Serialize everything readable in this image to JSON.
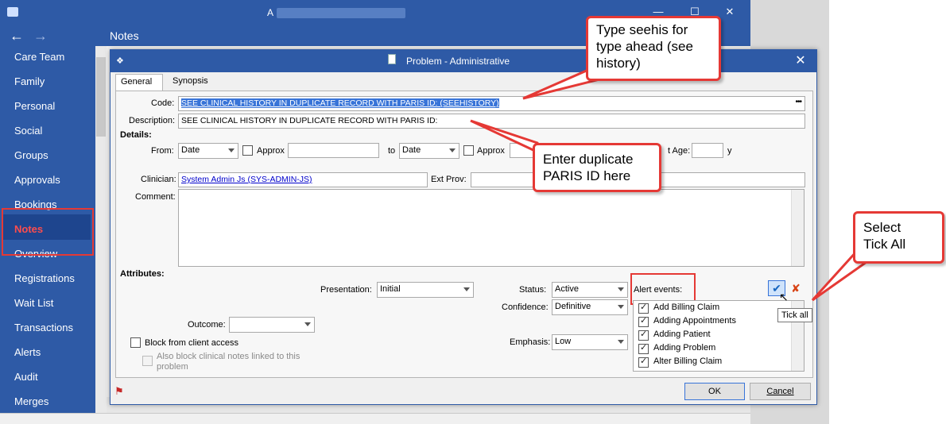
{
  "app": {
    "title": "A",
    "nav_title": "Notes",
    "back_icon": "arrow-left-icon",
    "forward_icon": "arrow-right-icon",
    "controls": [
      "minimize-icon",
      "maximize-icon",
      "close-icon"
    ]
  },
  "sidebar": {
    "items": [
      {
        "label": "Care Team"
      },
      {
        "label": "Family"
      },
      {
        "label": "Personal"
      },
      {
        "label": "Social"
      },
      {
        "label": "Groups"
      },
      {
        "label": "Approvals"
      },
      {
        "label": "Bookings"
      },
      {
        "label": "Notes"
      },
      {
        "label": "Overview"
      },
      {
        "label": "Registrations"
      },
      {
        "label": "Wait List"
      },
      {
        "label": "Transactions"
      },
      {
        "label": "Alerts"
      },
      {
        "label": "Audit"
      },
      {
        "label": "Merges"
      }
    ],
    "selected": "Notes"
  },
  "dialog": {
    "title": "Problem - Administrative",
    "tabs": {
      "general": "General",
      "synopsis": "Synopsis"
    },
    "code_label": "Code:",
    "code_value": "SEE CLINICAL HISTORY IN DUPLICATE RECORD WITH PARIS ID: (SEEHISTORY)",
    "description_label": "Description:",
    "description_value": "SEE CLINICAL HISTORY IN DUPLICATE RECORD WITH PARIS ID:",
    "details_label": "Details:",
    "from_label": "From:",
    "from_value": "Date",
    "approx_label": "Approx",
    "to_label": "to",
    "to_value": "Date",
    "approx2_label": "Approx",
    "age_label": "t Age:",
    "age_unit": "y",
    "clinician_label": "Clinician:",
    "clinician_value": "System Admin Js (SYS-ADMIN-JS)",
    "ext_prov_label": "Ext Prov:",
    "comment_label": "Comment:",
    "attributes_label": "Attributes:",
    "presentation_label": "Presentation:",
    "presentation_value": "Initial",
    "status_label": "Status:",
    "status_value": "Active",
    "confidence_label": "Confidence:",
    "confidence_value": "Definitive",
    "emphasis_label": "Emphasis:",
    "emphasis_value": "Low",
    "outcome_label": "Outcome:",
    "outcome_value": "",
    "block_label": "Block from client access",
    "also_block_line1": "Also block clinical notes linked to this",
    "also_block_line2": "problem",
    "alert_events_label": "Alert events:",
    "alert_events": [
      {
        "label": "Add Billing Claim",
        "checked": true
      },
      {
        "label": "Adding Appointments",
        "checked": true
      },
      {
        "label": "Adding Patient",
        "checked": true
      },
      {
        "label": "Adding Problem",
        "checked": true
      },
      {
        "label": "Alter Billing Claim",
        "checked": true
      }
    ],
    "tick_all_tooltip": "Tick all",
    "ok_label": "OK",
    "cancel_label": "Cancel"
  },
  "callouts": {
    "type_ahead": [
      "Type seehis for",
      "type ahead (see",
      "history)"
    ],
    "paris_id": [
      "Enter duplicate",
      "PARIS ID here"
    ],
    "tick_all": [
      "Select",
      "Tick All"
    ]
  },
  "colors": {
    "accent": "#2e5aa6",
    "callout_border": "#e53935",
    "selection": "#3874d8"
  }
}
